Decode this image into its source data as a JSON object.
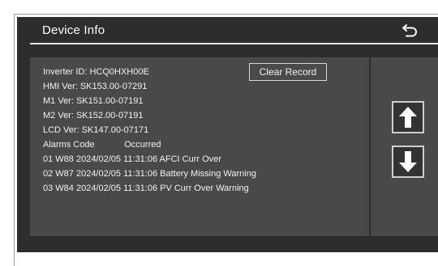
{
  "header": {
    "title": "Device Info",
    "back_icon": "back-return-icon"
  },
  "info": {
    "inverter_id": "Inverter ID: HCQ0HXH00E",
    "hmi_ver": "HMI Ver: SK153.00-07291",
    "m1_ver": "M1 Ver: SK151.00-07191",
    "m2_ver": "M2 Ver: SK152.00-07191",
    "lcd_ver": "LCD Ver: SK147.00-07171",
    "alarms_header": "Alarms Code            Occurred",
    "alarms": [
      "01 W88 2024/02/05 11:31:06 AFCI Curr Over",
      "02 W87 2024/02/05 11:31:06 Battery Missing Warning",
      "03 W84 2024/02/05 11:31:06 PV Curr Over Warning"
    ],
    "clear_record_label": "Clear Record"
  },
  "nav": {
    "up_icon": "arrow-up-icon",
    "down_icon": "arrow-down-icon"
  },
  "colors": {
    "background": "#2d2d2d",
    "panel": "#494949",
    "text": "#f2f2f2",
    "frame": "#ffffff"
  }
}
